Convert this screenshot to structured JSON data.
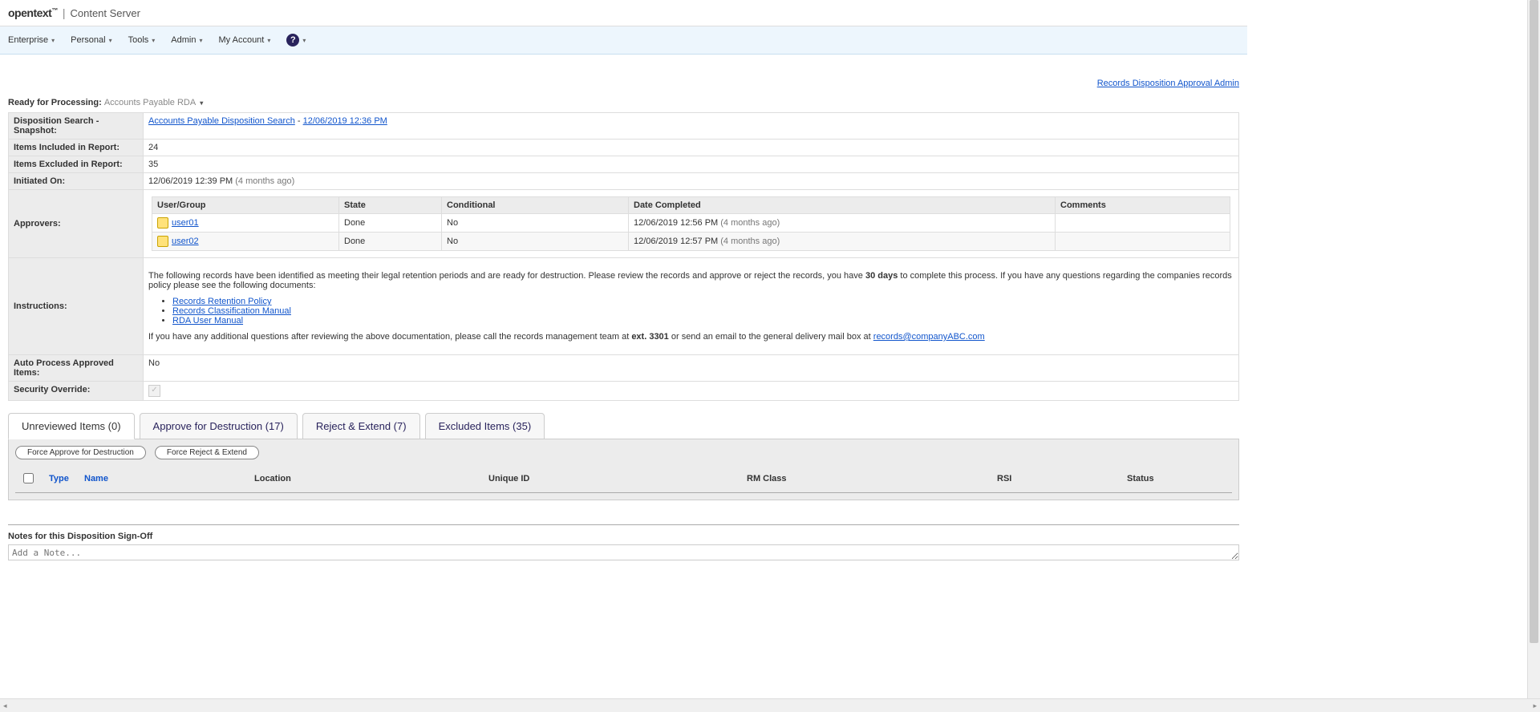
{
  "brand": {
    "company": "opentext",
    "tm": "™",
    "product": "Content Server"
  },
  "menu": {
    "items": [
      "Enterprise",
      "Personal",
      "Tools",
      "Admin",
      "My Account"
    ]
  },
  "topLink": "Records Disposition Approval Admin",
  "readyLabel": "Ready for Processing:",
  "rdaName": "Accounts Payable RDA",
  "info": {
    "dispositionSearchLabel": "Disposition Search - Snapshot:",
    "searchLink": "Accounts Payable Disposition Search",
    "snapshotTime": "12/06/2019 12:36 PM",
    "itemsIncludedLabel": "Items Included in Report:",
    "itemsIncluded": "24",
    "itemsExcludedLabel": "Items Excluded in Report:",
    "itemsExcluded": "35",
    "initiatedOnLabel": "Initiated On:",
    "initiatedOn": "12/06/2019 12:39 PM",
    "initiatedRel": "(4 months ago)",
    "approversLabel": "Approvers:",
    "instructionsLabel": "Instructions:",
    "autoProcessLabel": "Auto Process Approved Items:",
    "autoProcess": "No",
    "securityOverrideLabel": "Security Override:"
  },
  "approversHeaders": {
    "user": "User/Group",
    "state": "State",
    "conditional": "Conditional",
    "date": "Date Completed",
    "comments": "Comments"
  },
  "approvers": [
    {
      "user": "user01",
      "state": "Done",
      "conditional": "No",
      "date": "12/06/2019 12:56 PM",
      "rel": "(4 months ago)",
      "comments": ""
    },
    {
      "user": "user02",
      "state": "Done",
      "conditional": "No",
      "date": "12/06/2019 12:57 PM",
      "rel": "(4 months ago)",
      "comments": ""
    }
  ],
  "instructions": {
    "p1a": "The following records have been identified as meeting their legal retention periods and are ready for destruction. Please review the records and approve or reject the records, you have ",
    "p1b": "30 days",
    "p1c": " to complete this process. If you have any questions regarding the companies records policy please see the following documents:",
    "docs": [
      "Records Retention Policy",
      "Records Classification Manual",
      "RDA User Manual"
    ],
    "p2a": "If you have any additional questions after reviewing the above documentation, please call the records management team at ",
    "ext": "ext. 3301",
    "p2b": " or send an email to the general delivery mail box at ",
    "email": "records@companyABC.com"
  },
  "tabs": {
    "unreviewed": "Unreviewed Items (0)",
    "approve": "Approve for Destruction (17)",
    "reject": "Reject & Extend (7)",
    "excluded": "Excluded Items (35)"
  },
  "actions": {
    "forceApprove": "Force Approve for Destruction",
    "forceReject": "Force Reject & Extend"
  },
  "itemsHeaders": {
    "type": "Type",
    "name": "Name",
    "location": "Location",
    "uid": "Unique ID",
    "rmclass": "RM Class",
    "rsi": "RSI",
    "status": "Status"
  },
  "notesLabel": "Notes for this Disposition Sign-Off",
  "notesPlaceholder": "Add a Note..."
}
